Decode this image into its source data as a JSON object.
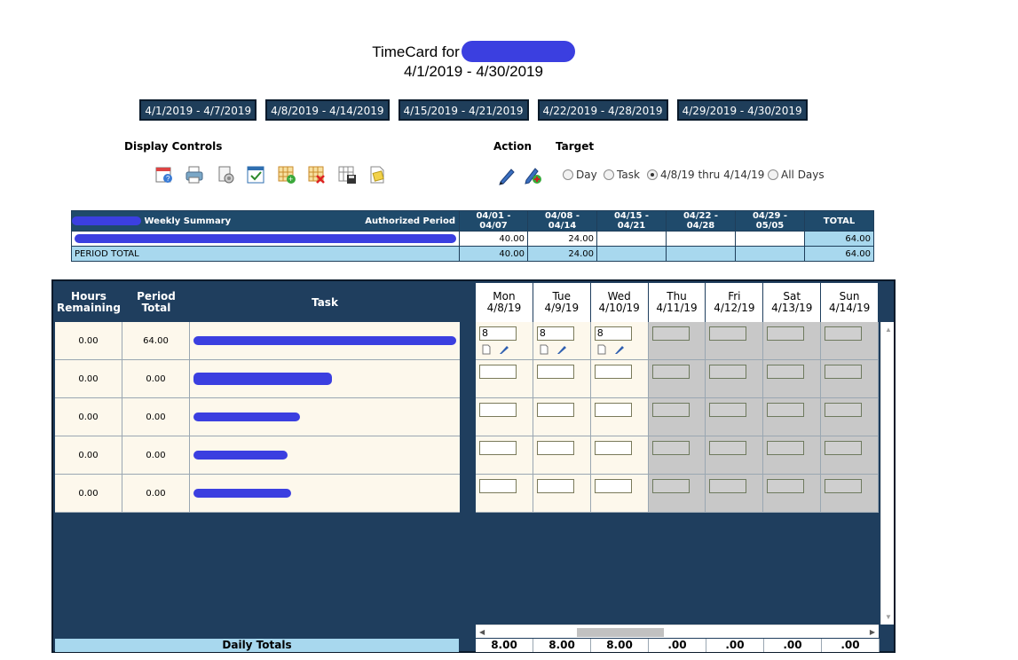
{
  "header": {
    "title_prefix": "TimeCard for",
    "period": "4/1/2019 - 4/30/2019"
  },
  "weeks": [
    {
      "label": "4/1/2019 - 4/7/2019"
    },
    {
      "label": "4/8/2019 - 4/14/2019"
    },
    {
      "label": "4/15/2019 - 4/21/2019"
    },
    {
      "label": "4/22/2019 - 4/28/2019"
    },
    {
      "label": "4/29/2019 - 4/30/2019"
    }
  ],
  "controls": {
    "display_label": "Display Controls",
    "action_label": "Action",
    "target_label": "Target",
    "display_icons": [
      "calendar-help-icon",
      "print-icon",
      "print-setup-icon",
      "calendar-check-icon",
      "add-grid-icon",
      "delete-grid-icon",
      "save-grid-icon",
      "notes-icon"
    ],
    "action_icons": [
      "edit-pencil-icon",
      "copy-edit-icon"
    ],
    "targets": [
      {
        "label": "Day",
        "selected": false
      },
      {
        "label": "Task",
        "selected": false
      },
      {
        "label": "4/8/19 thru 4/14/19",
        "selected": true
      },
      {
        "label": "All Days",
        "selected": false
      }
    ]
  },
  "summary": {
    "title": "Weekly Summary",
    "authorized_label": "Authorized Period",
    "columns": [
      "04/01 - 04/07",
      "04/08 - 04/14",
      "04/15 - 04/21",
      "04/22 - 04/28",
      "04/29 - 05/05",
      "TOTAL"
    ],
    "row": [
      "40.00",
      "24.00",
      "",
      "",
      "",
      "64.00"
    ],
    "total_label": "PERIOD TOTAL",
    "total_row": [
      "40.00",
      "24.00",
      "",
      "",
      "",
      "64.00"
    ]
  },
  "grid": {
    "headers": {
      "hours_remaining": "Hours Remaining",
      "period_total": "Period Total",
      "task": "Task"
    },
    "days": [
      {
        "dow": "Mon",
        "date": "4/8/19"
      },
      {
        "dow": "Tue",
        "date": "4/9/19"
      },
      {
        "dow": "Wed",
        "date": "4/10/19"
      },
      {
        "dow": "Thu",
        "date": "4/11/19"
      },
      {
        "dow": "Fri",
        "date": "4/12/19"
      },
      {
        "dow": "Sat",
        "date": "4/13/19"
      },
      {
        "dow": "Sun",
        "date": "4/14/19"
      }
    ],
    "rows": [
      {
        "hours_remaining": "0.00",
        "period_total": "64.00",
        "entries": [
          "8",
          "8",
          "8",
          "",
          "",
          "",
          ""
        ]
      },
      {
        "hours_remaining": "0.00",
        "period_total": "0.00",
        "entries": [
          "",
          "",
          "",
          "",
          "",
          "",
          ""
        ]
      },
      {
        "hours_remaining": "0.00",
        "period_total": "0.00",
        "entries": [
          "",
          "",
          "",
          "",
          "",
          "",
          ""
        ]
      },
      {
        "hours_remaining": "0.00",
        "period_total": "0.00",
        "entries": [
          "",
          "",
          "",
          "",
          "",
          "",
          ""
        ]
      },
      {
        "hours_remaining": "0.00",
        "period_total": "0.00",
        "entries": [
          "",
          "",
          "",
          "",
          "",
          "",
          ""
        ]
      }
    ],
    "daily_totals_label": "Daily Totals",
    "daily_totals": [
      "8.00",
      "8.00",
      "8.00",
      ".00",
      ".00",
      ".00",
      ".00"
    ]
  },
  "colors": {
    "navy": "#1f3e5e",
    "light_blue": "#a8d8ee",
    "cream": "#fdf8ec",
    "redaction": "#3b3fe0"
  }
}
